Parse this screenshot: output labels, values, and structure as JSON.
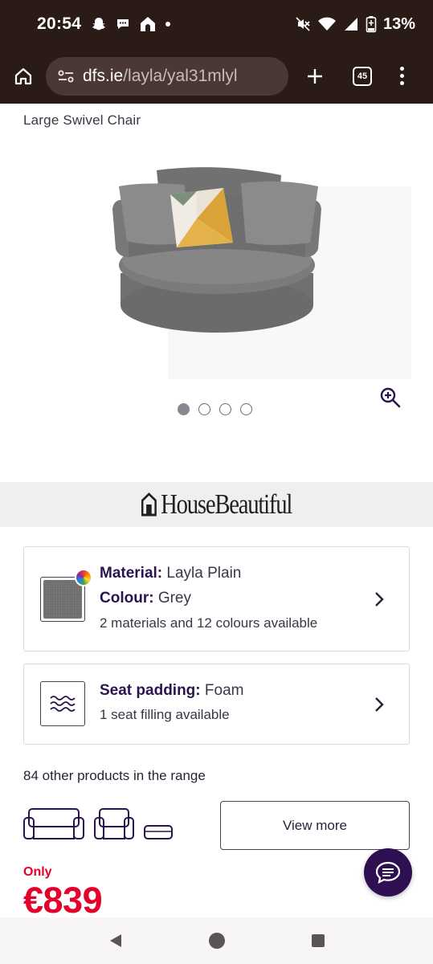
{
  "status_bar": {
    "time": "20:54",
    "battery_percent": "13%",
    "left_icons": [
      "snapchat-icon",
      "chat-bubble-icon",
      "home-app-icon",
      "dot-icon"
    ],
    "right_icons": [
      "mute-icon",
      "wifi-icon",
      "signal-icon",
      "battery-icon"
    ]
  },
  "browser": {
    "url_host": "dfs.ie",
    "url_path": "/layla/yal31mlyl",
    "tab_count": "45"
  },
  "product": {
    "subtitle": "Large Swivel Chair",
    "image_count": 4,
    "active_image_index": 0
  },
  "brand": {
    "name": "HouseBeautiful"
  },
  "options": {
    "material_label": "Material:",
    "material_value": " Layla Plain",
    "colour_label": "Colour:",
    "colour_value": " Grey",
    "material_availability": "2 materials and 12 colours available",
    "seat_padding_label": "Seat padding:",
    "seat_padding_value": " Foam",
    "seat_availability": "1 seat filling available"
  },
  "range": {
    "text": "84 other products in the range",
    "view_more_label": "View more"
  },
  "pricing": {
    "only_label": "Only",
    "price": "€839"
  },
  "colors": {
    "accent_price": "#e4002b",
    "brand_purple": "#2e0f52",
    "browser_bar": "#2b1b17"
  }
}
